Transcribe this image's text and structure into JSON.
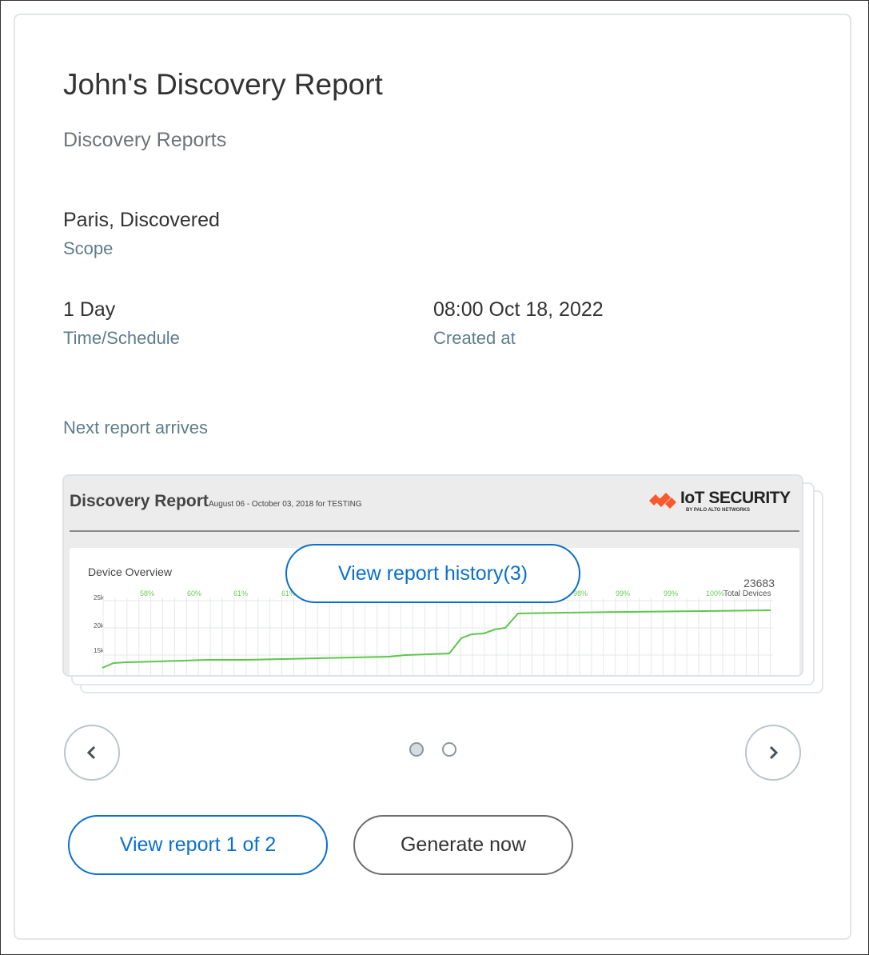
{
  "report": {
    "title": "John's Discovery Report",
    "subtitle": "Discovery Reports",
    "scope_value": "Paris, Discovered",
    "scope_label": "Scope",
    "schedule_value": "1 Day",
    "schedule_label": "Time/Schedule",
    "created_value": "08:00 Oct 18, 2022",
    "created_label": "Created at",
    "next_label": "Next report arrives"
  },
  "preview": {
    "heading": "Discovery Report",
    "date_range": "August 06 - October 03, 2018  for TESTING",
    "logo_text": "IoT SECURITY",
    "logo_sub": "BY PALO ALTO NETWORKS",
    "section": "Device Overview",
    "total": "23683",
    "total_label": "Total Devices",
    "y_ticks": [
      "25k",
      "20k",
      "15k"
    ],
    "percents": [
      "58%",
      "60%",
      "61%",
      "61%",
      "98%",
      "99%",
      "99%",
      "100%"
    ],
    "history_button": "View report history(3)"
  },
  "carousel": {
    "current_page": 1,
    "page_count": 2
  },
  "actions": {
    "view_report": "View report 1 of 2",
    "generate": "Generate now"
  },
  "colors": {
    "accent": "#0a6fce",
    "line": "#5cc74a",
    "logo": "#fa582d"
  }
}
